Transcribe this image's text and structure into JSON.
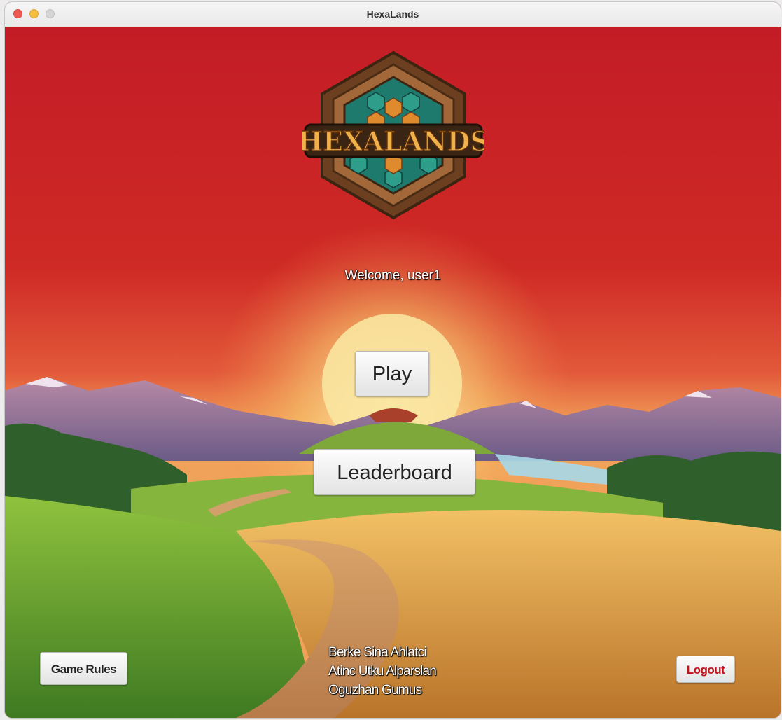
{
  "window": {
    "title": "HexaLands"
  },
  "logo": {
    "text": "HEXALANDS",
    "icon": "hexalands-hexagon-logo"
  },
  "welcome": {
    "text": "Welcome, user1"
  },
  "buttons": {
    "play": "Play",
    "leaderboard": "Leaderboard",
    "game_rules": "Game Rules",
    "logout": "Logout"
  },
  "credits": [
    "Berke Sina Ahlatci",
    "Atinc Utku Alparslan",
    "Oguzhan Gumus"
  ],
  "colors": {
    "sky": "#c9202a",
    "sun": "#f7e39a",
    "field_gold": "#d99b3a",
    "grass": "#6fae32",
    "logout_text": "#c1121b"
  }
}
